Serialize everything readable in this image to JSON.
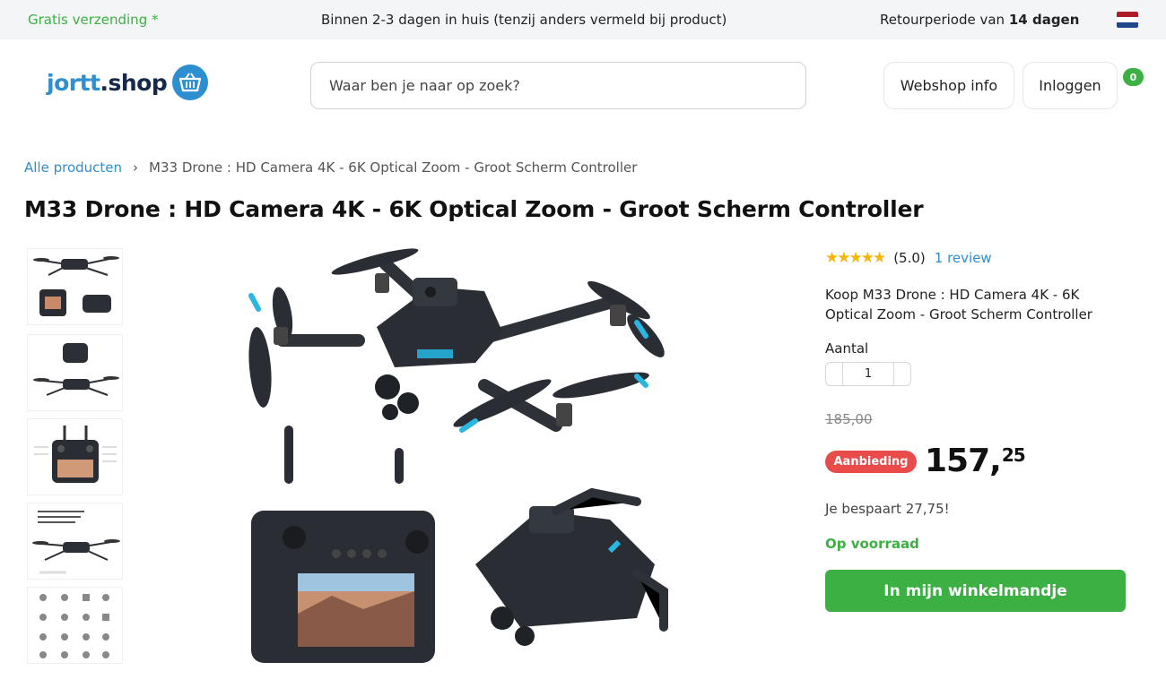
{
  "topbar": {
    "shipping": "Gratis verzending *",
    "delivery": "Binnen 2-3 dagen in huis (tenzij anders vermeld bij product)",
    "return_prefix": "Retourperiode van",
    "return_days": "14 dagen",
    "flag_colors": [
      "#ae1c28",
      "#ffffff",
      "#21468b"
    ]
  },
  "header": {
    "logo_part1": "jortt",
    "logo_part2": ".shop",
    "search_placeholder": "Waar ben je naar op zoek?",
    "webshop_info": "Webshop info",
    "login": "Inloggen",
    "cart_count": "0"
  },
  "breadcrumb": {
    "root": "Alle producten",
    "separator": "›",
    "current": "M33 Drone : HD Camera 4K - 6K Optical Zoom - Groot Scherm Controller"
  },
  "product": {
    "title": "M33 Drone : HD Camera 4K - 6K Optical Zoom - Groot Scherm Controller",
    "stars": "★★★★★",
    "rating": "(5.0)",
    "reviews": "1 review",
    "description": "Koop M33 Drone : HD Camera 4K - 6K Optical Zoom - Groot Scherm Controller",
    "quantity_label": "Aantal",
    "quantity": "1",
    "old_price": "185,00",
    "sale_label": "Aanbieding",
    "price_main": "157,",
    "price_cents": "25",
    "savings": "Je bespaart 27,75!",
    "stock": "Op voorraad",
    "add_to_cart": "In mijn winkelmandje",
    "thumbnail_count": 5
  },
  "colors": {
    "brand_blue": "#2d8fd0",
    "accent_green": "#3cb043",
    "sale_red": "#e94a4a",
    "star_gold": "#f5b50a"
  }
}
